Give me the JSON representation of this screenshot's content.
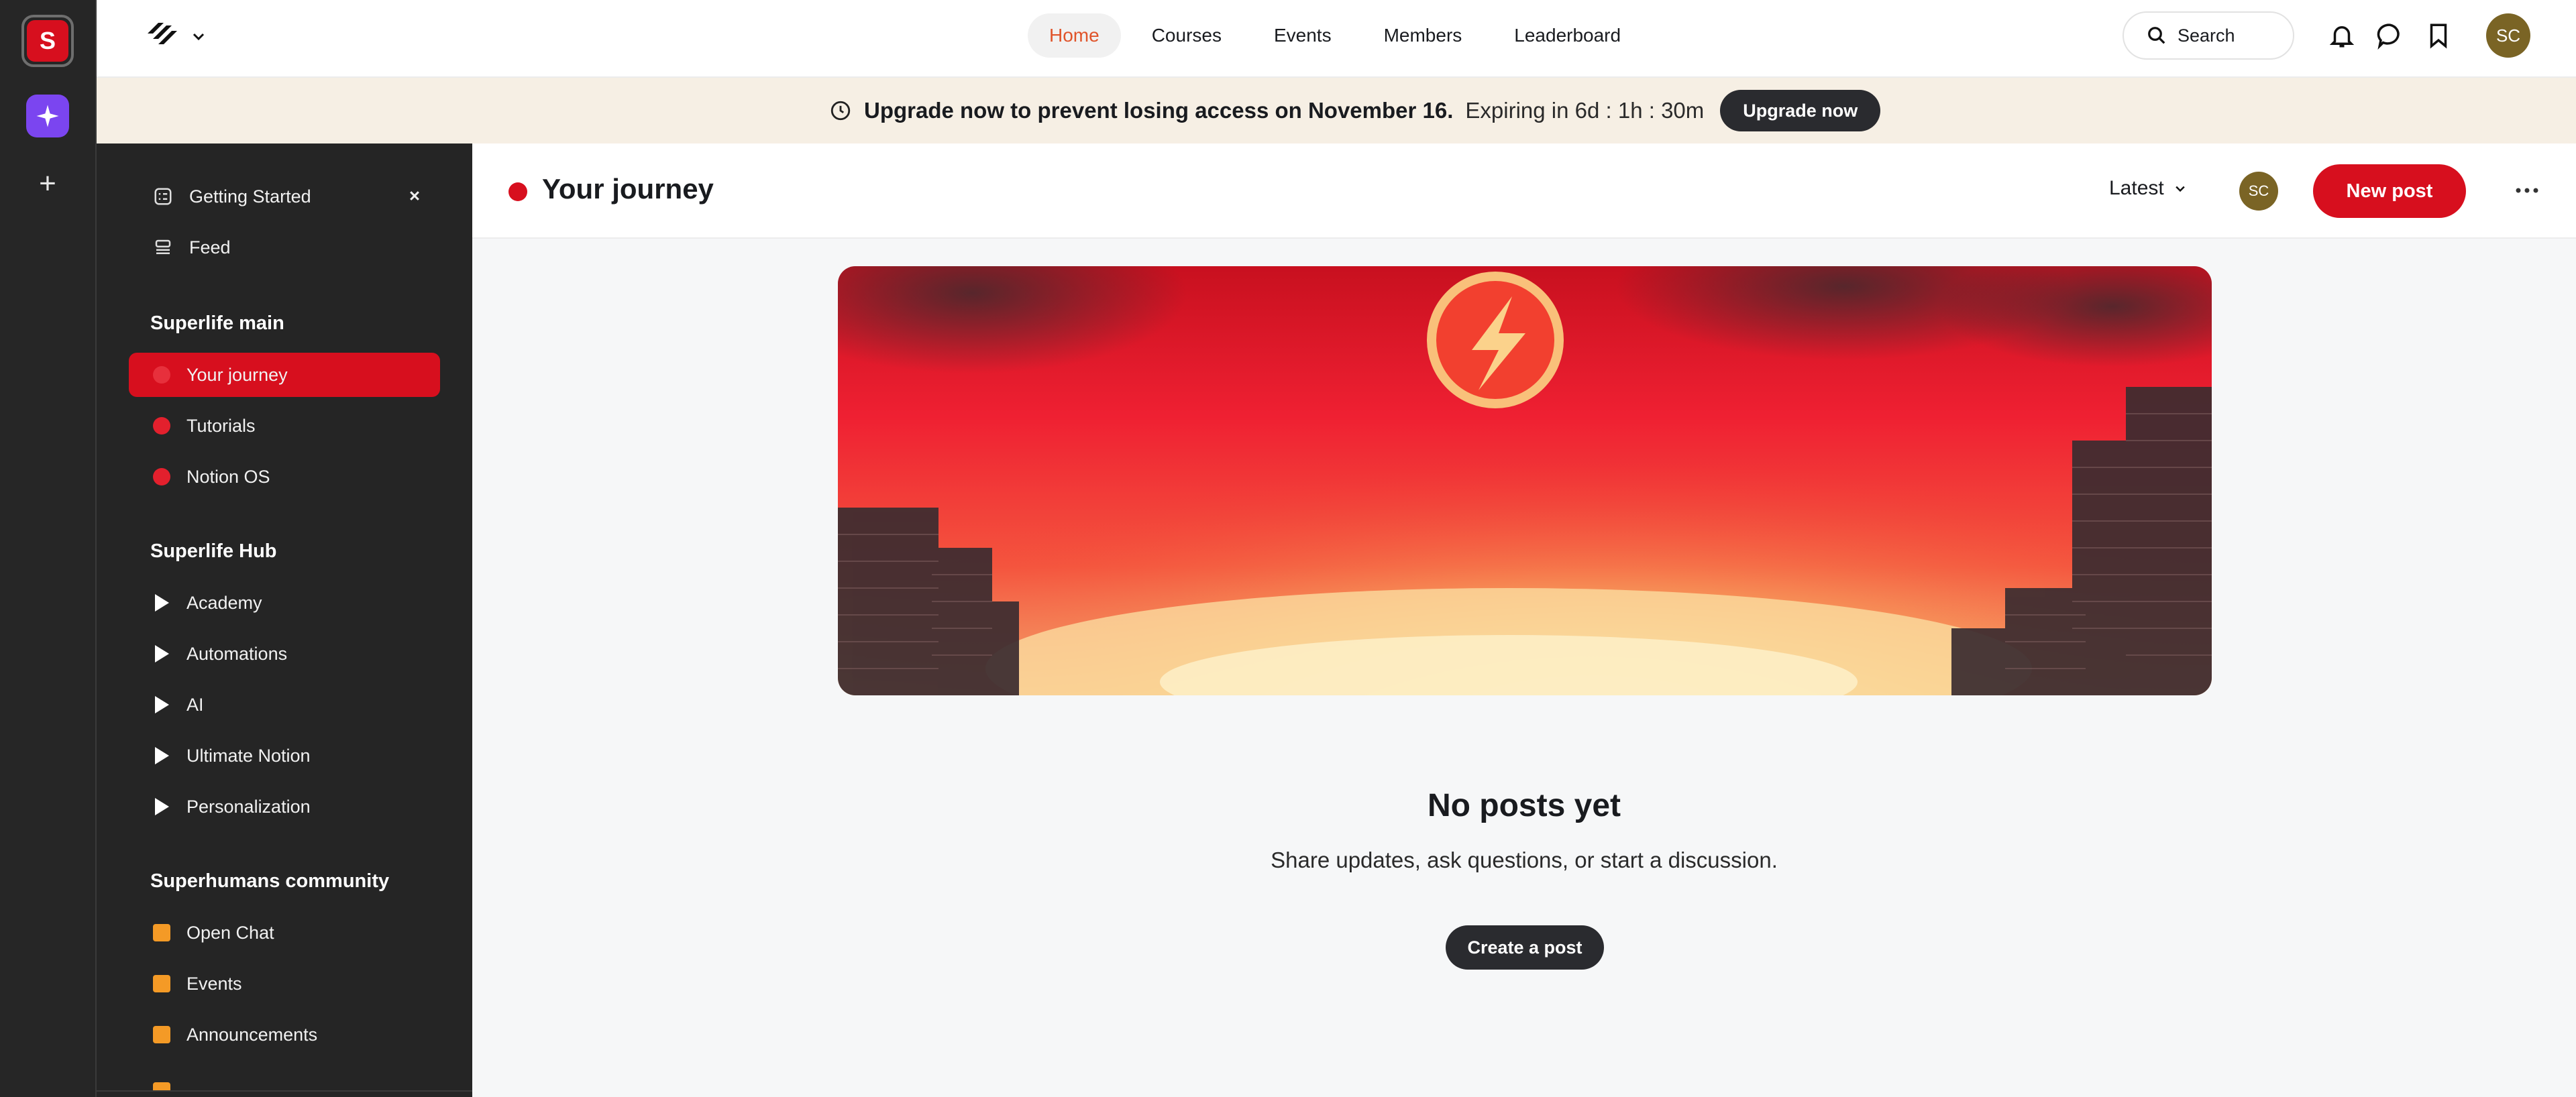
{
  "rail": {
    "community_initial": "S"
  },
  "header": {
    "nav": [
      "Home",
      "Courses",
      "Events",
      "Members",
      "Leaderboard"
    ],
    "search_label": "Search",
    "user_initials": "SC"
  },
  "banner": {
    "message": "Upgrade now to prevent losing access on November 16.",
    "expiry": "Expiring in 6d : 1h : 30m",
    "button": "Upgrade now"
  },
  "sidebar": {
    "top_items": [
      "Getting Started",
      "Feed"
    ],
    "sections": [
      {
        "title": "Superlife main",
        "items": [
          "Your journey",
          "Tutorials",
          "Notion OS"
        ]
      },
      {
        "title": "Superlife Hub",
        "items": [
          "Academy",
          "Automations",
          "AI",
          "Ultimate Notion",
          "Personalization"
        ]
      },
      {
        "title": "Superhumans community",
        "items": [
          "Open Chat",
          "Events",
          "Announcements"
        ]
      }
    ]
  },
  "main": {
    "title": "Your journey",
    "sort": "Latest",
    "avatar_initials": "SC",
    "new_post": "New post",
    "empty_title": "No posts yet",
    "empty_subtitle": "Share updates, ask questions, or start a discussion.",
    "create_button": "Create a post"
  },
  "colors": {
    "brand_red": "#d70f1e",
    "accent_orange": "#e0542a",
    "rail_purple": "#7b45f0",
    "sidebar_bg": "#252525"
  }
}
